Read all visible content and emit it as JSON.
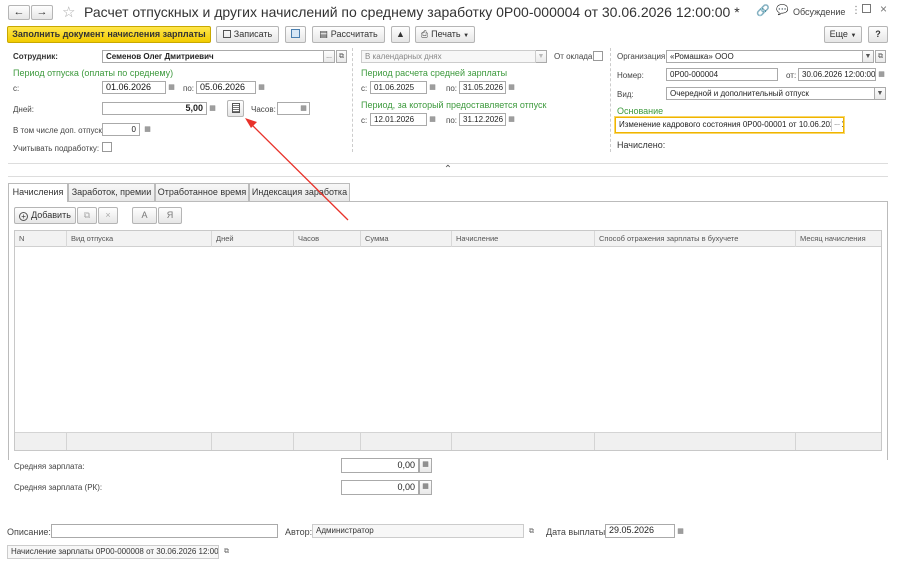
{
  "window": {
    "title": "Расчет отпускных и других начислений по среднему заработку 0Р00-000004 от 30.06.2026 12:00:00 *",
    "discussion_label": "Обсуждение"
  },
  "toolbar": {
    "fill_label": "Заполнить документ начисления зарплаты",
    "save_label": "Записать",
    "calc_label": "Рассчитать",
    "print_label": "Печать",
    "more_label": "Еще",
    "help_label": "?"
  },
  "employee": {
    "label": "Сотрудник:",
    "value": "Семенов Олег Дмитриевич"
  },
  "vacation_period": {
    "heading": "Период отпуска (оплаты по среднему)",
    "from_label": "с:",
    "from_value": "01.06.2026",
    "to_label": "по:",
    "to_value": "05.06.2026",
    "days_label": "Дней:",
    "days_value": "5,00",
    "hours_label": "Часов:",
    "hours_value": "",
    "extra_label": "В том числе доп. отпуска:",
    "extra_value": "0",
    "parttime_label": "Учитывать подработку:"
  },
  "middle": {
    "calendar_days_placeholder": "В календарных днях",
    "by_salary_label": "От оклада:",
    "avg_period_heading": "Период расчета средней зарплаты",
    "avg_from_label": "с:",
    "avg_from": "01.06.2025",
    "avg_to_label": "по:",
    "avg_to": "31.05.2026",
    "provided_heading": "Период, за который предоставляется отпуск",
    "prov_from_label": "с:",
    "prov_from": "12.01.2026",
    "prov_to_label": "по:",
    "prov_to": "31.12.2026"
  },
  "right": {
    "org_label": "Организация:",
    "org_value": "«Ромашка» ООО",
    "number_label": "Номер:",
    "number_value": "0Р00-000004",
    "date_label": "от:",
    "date_value": "30.06.2026 12:00:00",
    "kind_label": "Вид:",
    "kind_value": "Очередной и дополнительный отпуск",
    "basis_heading": "Основание",
    "basis_value": "Изменение кадрового состояния 0Р00-00001 от 10.06.2026 16",
    "accrued_label": "Начислено:"
  },
  "tabs": [
    {
      "label": "Начисления"
    },
    {
      "label": "Заработок, премии"
    },
    {
      "label": "Отработанное время"
    },
    {
      "label": "Индексация заработка"
    }
  ],
  "grid": {
    "add_label": "Добавить",
    "a_label": "А",
    "ya_label": "Я",
    "columns": [
      "N",
      "Вид отпуска",
      "Дней",
      "Часов",
      "Сумма",
      "Начисление",
      "Способ отражения зарплаты в бухучете",
      "Месяц начисления"
    ]
  },
  "averages": {
    "avg_label": "Средняя зарплата:",
    "avg_value": "0,00",
    "avg_rk_label": "Средняя зарплата (РК):",
    "avg_rk_value": "0,00"
  },
  "footer": {
    "desc_label": "Описание:",
    "desc_value": "",
    "author_label": "Автор:",
    "author_value": "Администратор",
    "paydate_label": "Дата выплаты:",
    "paydate_value": "29.05.2026",
    "payroll_link": "Начисление зарплаты 0Р00-000008 от 30.06.2026 12:00:00"
  },
  "colors": {
    "accent_yellow": "#f2cb00",
    "heading_green": "#3d9a3d",
    "annotation_red": "#e8322a",
    "focus_orange": "#f0b400"
  },
  "icons": [
    "back-arrow-icon",
    "forward-arrow-icon",
    "star-icon",
    "link-icon",
    "discussion-icon",
    "menu-icon",
    "maximize-icon",
    "close-icon",
    "calendar-icon",
    "calculator-icon",
    "collapse-icon",
    "add-icon",
    "copy-icon",
    "delete-icon",
    "print-icon"
  ]
}
